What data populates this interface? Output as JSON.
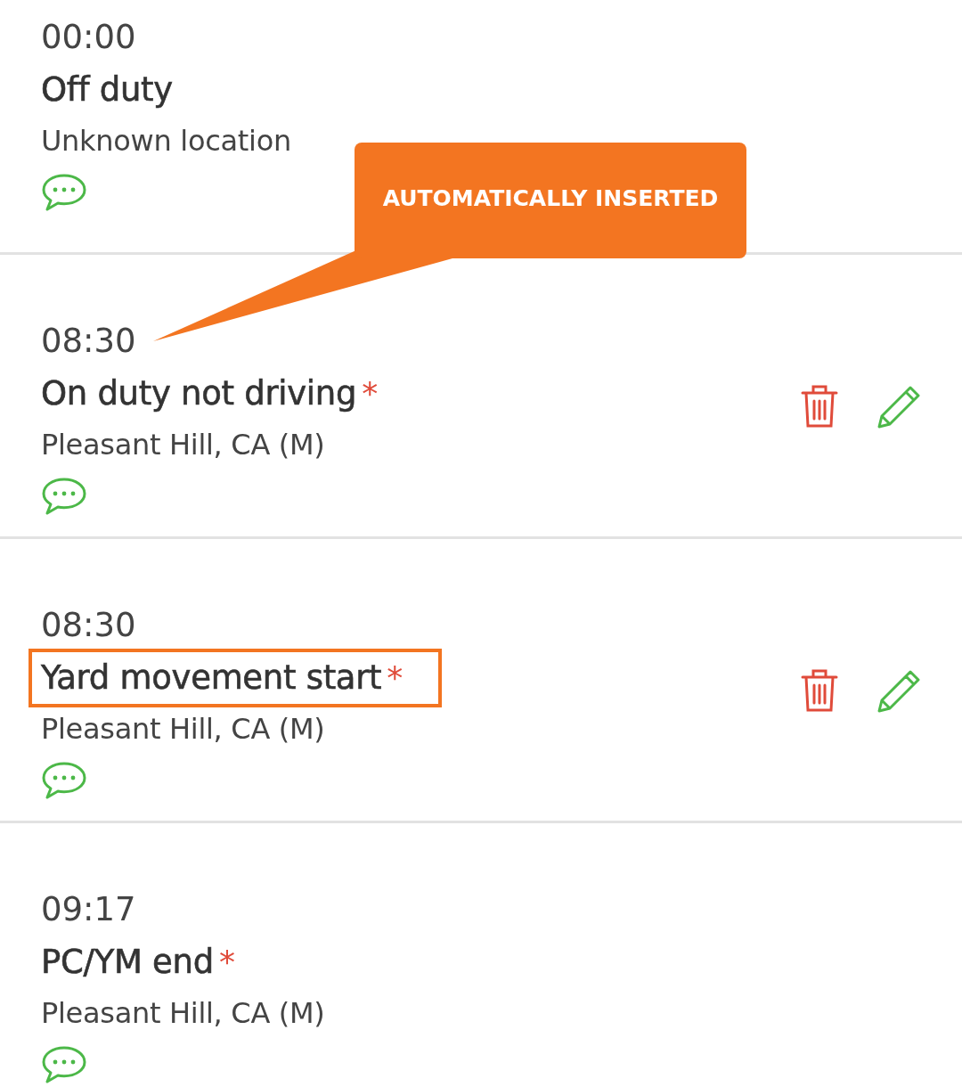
{
  "entries": [
    {
      "time": "00:00",
      "status": "Off duty",
      "location": "Unknown location",
      "highlighted": false,
      "deletable": false,
      "editable": false
    },
    {
      "time": "08:30",
      "status": "On duty not driving",
      "required_mark": "*",
      "location": "Pleasant Hill, CA (M)",
      "highlighted": false,
      "deletable": true,
      "editable": true
    },
    {
      "time": "08:30",
      "status": "Yard movement start",
      "required_mark": "*",
      "location": "Pleasant Hill, CA (M)",
      "highlighted": true,
      "deletable": true,
      "editable": true
    },
    {
      "time": "09:17",
      "status": "PC/YM end",
      "required_mark": "*",
      "location": "Pleasant Hill, CA (M)",
      "highlighted": false,
      "deletable": false,
      "editable": false
    }
  ],
  "callout": {
    "text": "AUTOMATICALLY INSERTED"
  }
}
